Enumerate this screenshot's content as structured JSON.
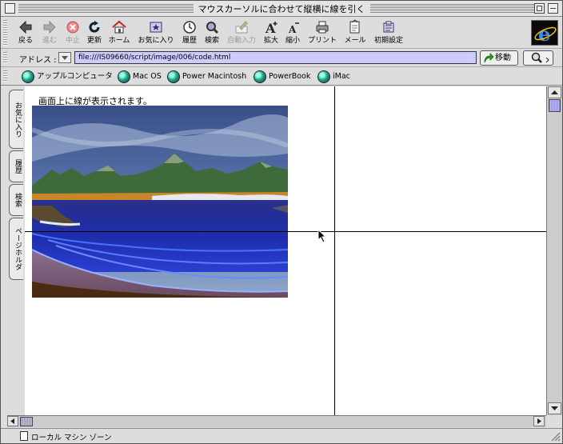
{
  "window": {
    "title": "マウスカーソルに合わせて縦横に線を引く"
  },
  "toolbar": {
    "buttons": [
      {
        "label": "戻る",
        "icon": "back-arrow-icon"
      },
      {
        "label": "進む",
        "icon": "forward-arrow-icon"
      },
      {
        "label": "中止",
        "icon": "stop-icon"
      },
      {
        "label": "更新",
        "icon": "refresh-icon"
      },
      {
        "label": "ホーム",
        "icon": "home-icon"
      },
      {
        "label": "お気に入り",
        "icon": "favorites-icon"
      },
      {
        "label": "履歴",
        "icon": "history-icon"
      },
      {
        "label": "検索",
        "icon": "search-icon"
      },
      {
        "label": "自動入力",
        "icon": "autofill-icon"
      },
      {
        "label": "拡大",
        "icon": "text-larger-icon"
      },
      {
        "label": "縮小",
        "icon": "text-smaller-icon"
      },
      {
        "label": "プリント",
        "icon": "print-icon"
      },
      {
        "label": "メール",
        "icon": "mail-icon"
      },
      {
        "label": "初期設定",
        "icon": "preferences-icon"
      }
    ]
  },
  "address": {
    "label": "アドレス :",
    "value": "file:///IS09660/script/image/006/code.html",
    "go_label": "移動"
  },
  "favorites": [
    "アップルコンピュータ",
    "Mac OS",
    "Power Macintosh",
    "PowerBook",
    "iMac"
  ],
  "sidetabs": [
    "お気に入り",
    "履歴",
    "検索",
    "ページホルダ"
  ],
  "content": {
    "message": "画面上に線が表示されます。"
  },
  "status": {
    "text": "ローカル マシン ゾーン"
  },
  "colors": {
    "address_bg": "#ccccff",
    "scroll_thumb": "#bbbbff"
  }
}
